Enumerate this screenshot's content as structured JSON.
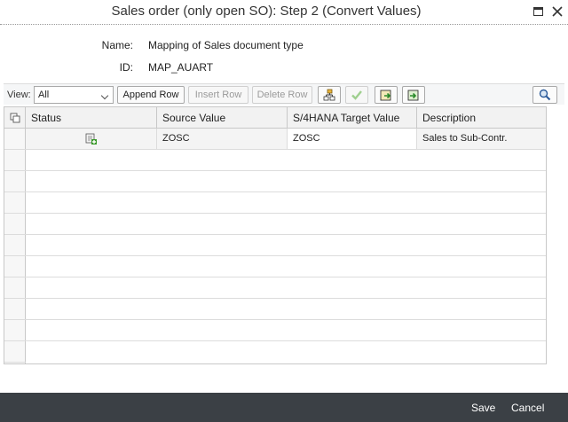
{
  "window": {
    "title": "Sales order (only open SO): Step 2 (Convert Values)"
  },
  "info": {
    "name_label": "Name:",
    "name_value": "Mapping of Sales document type",
    "id_label": "ID:",
    "id_value": "MAP_AUART"
  },
  "toolbar": {
    "view_label": "View:",
    "view_selected": "All",
    "append_row": "Append Row",
    "insert_row": "Insert Row",
    "delete_row": "Delete Row",
    "icons": [
      "hierarchy-icon",
      "checkmark-icon",
      "export-icon",
      "import-icon",
      "search-icon"
    ]
  },
  "table": {
    "columns": [
      "Status",
      "Source Value",
      "S/4HANA Target Value",
      "Description"
    ],
    "rows": [
      {
        "status_icon": "add-entry-icon",
        "source": "ZOSC",
        "target": "ZOSC",
        "description": "Sales to Sub-Contr."
      }
    ]
  },
  "footer": {
    "save": "Save",
    "cancel": "Cancel"
  },
  "colors": {
    "footer_bg": "#3b4045",
    "toolbar_bg": "#f5f6f7",
    "grid_border": "#c8c8c8",
    "icon_green": "#3a9a2a"
  }
}
